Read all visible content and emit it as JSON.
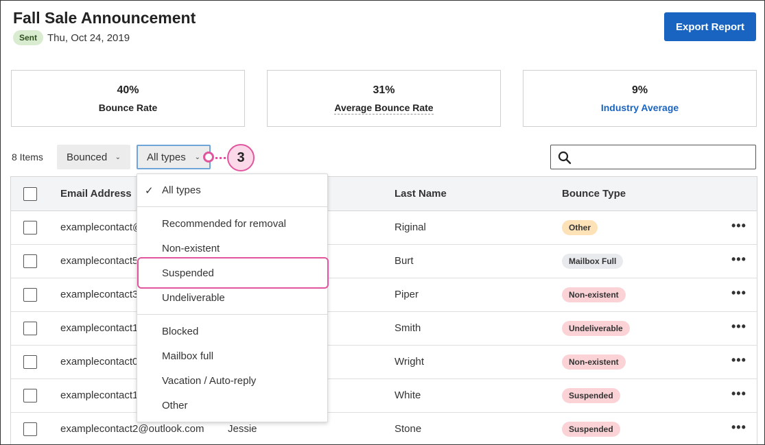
{
  "header": {
    "title": "Fall Sale Announcement",
    "status_badge": "Sent",
    "date": "Thu, Oct 24, 2019",
    "export_label": "Export Report"
  },
  "stats": [
    {
      "value": "40%",
      "label": "Bounce Rate"
    },
    {
      "value": "31%",
      "label": "Average Bounce Rate"
    },
    {
      "value": "9%",
      "label": "Industry Average"
    }
  ],
  "toolbar": {
    "items_count": "8 Items",
    "filter_status": "Bounced",
    "filter_type": "All types",
    "callout_number": "3"
  },
  "table": {
    "headers": {
      "email": "Email Address",
      "last_name": "Last Name",
      "bounce_type": "Bounce Type"
    },
    "rows": [
      {
        "email": "examplecontact@",
        "first": "",
        "last": "Riginal",
        "bounce": "Other"
      },
      {
        "email": "examplecontact5",
        "first": "",
        "last": "Burt",
        "bounce": "Mailbox Full"
      },
      {
        "email": "examplecontact3",
        "first": "",
        "last": "Piper",
        "bounce": "Non-existent"
      },
      {
        "email": "examplecontact1",
        "first": "",
        "last": "Smith",
        "bounce": "Undeliverable"
      },
      {
        "email": "examplecontact0",
        "first": "",
        "last": "Wright",
        "bounce": "Non-existent"
      },
      {
        "email": "examplecontact1",
        "first": "",
        "last": "White",
        "bounce": "Suspended"
      },
      {
        "email": "examplecontact2@outlook.com",
        "first": "Jessie",
        "last": "Stone",
        "bounce": "Suspended"
      }
    ]
  },
  "dropdown": {
    "options": [
      {
        "label": "All types",
        "selected": true
      },
      {
        "label": "Recommended for removal"
      },
      {
        "label": "Non-existent"
      },
      {
        "label": "Suspended"
      },
      {
        "label": "Undeliverable"
      },
      {
        "label": "Blocked"
      },
      {
        "label": "Mailbox full"
      },
      {
        "label": "Vacation / Auto-reply"
      },
      {
        "label": "Other"
      }
    ]
  },
  "colors": {
    "accent": "#1a64c1",
    "highlight": "#e0559d",
    "badge_other": "#fde2b8",
    "badge_mailbox": "#e8eaed",
    "badge_red": "#fbd3d6"
  }
}
